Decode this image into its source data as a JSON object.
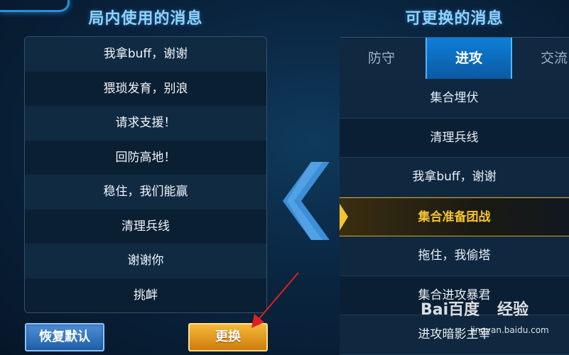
{
  "left_panel": {
    "title": "局内使用的消息",
    "items": [
      "我拿buff，谢谢",
      "猥琐发育，别浪",
      "请求支援！",
      "回防高地！",
      "稳住，我们能赢",
      "清理兵线",
      "谢谢你",
      "挑衅"
    ]
  },
  "buttons": {
    "restore_default": "恢复默认",
    "replace": "更换"
  },
  "right_panel": {
    "title": "可更换的消息",
    "tabs": [
      {
        "label": "防守",
        "active": false
      },
      {
        "label": "进攻",
        "active": true
      },
      {
        "label": "交流",
        "active": false
      }
    ],
    "items": [
      "集合埋伏",
      "清理兵线",
      "我拿buff，谢谢",
      "集合准备团战",
      "拖住，我偷塔",
      "集合进攻暴君",
      "进攻暗影主宰"
    ],
    "selected_index": 3
  },
  "watermark": {
    "brand": "Bai百度",
    "jingyan": "经验",
    "url": "jingyan.baidu.com"
  },
  "colors": {
    "accent_blue": "#2d8fd1",
    "selected_gold": "#f5c431",
    "button_orange": "#e89a1e",
    "pointer_red": "#e0201e"
  }
}
